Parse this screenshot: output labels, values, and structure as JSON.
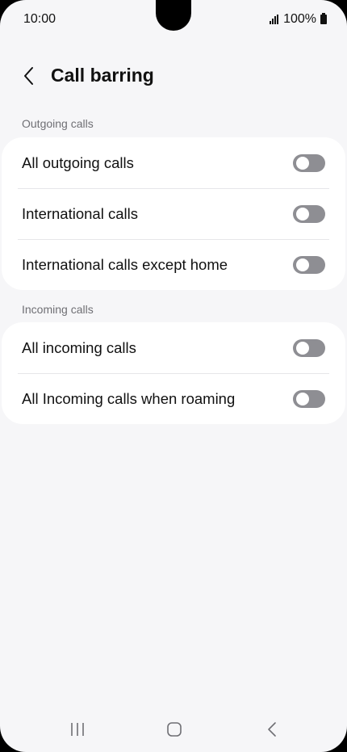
{
  "status_bar": {
    "time": "10:00",
    "battery": "100%"
  },
  "header": {
    "title": "Call barring"
  },
  "sections": [
    {
      "label": "Outgoing calls",
      "items": [
        {
          "label": "All outgoing calls",
          "enabled": false
        },
        {
          "label": "International calls",
          "enabled": false
        },
        {
          "label": "International calls except home",
          "enabled": false
        }
      ]
    },
    {
      "label": "Incoming calls",
      "items": [
        {
          "label": "All incoming calls",
          "enabled": false
        },
        {
          "label": "All Incoming calls when roaming",
          "enabled": false
        }
      ]
    }
  ],
  "colors": {
    "background": "#f6f6f8",
    "card": "#ffffff",
    "toggle_off": "#8e8e93",
    "text": "#111111",
    "section_label": "#6f6f74"
  }
}
